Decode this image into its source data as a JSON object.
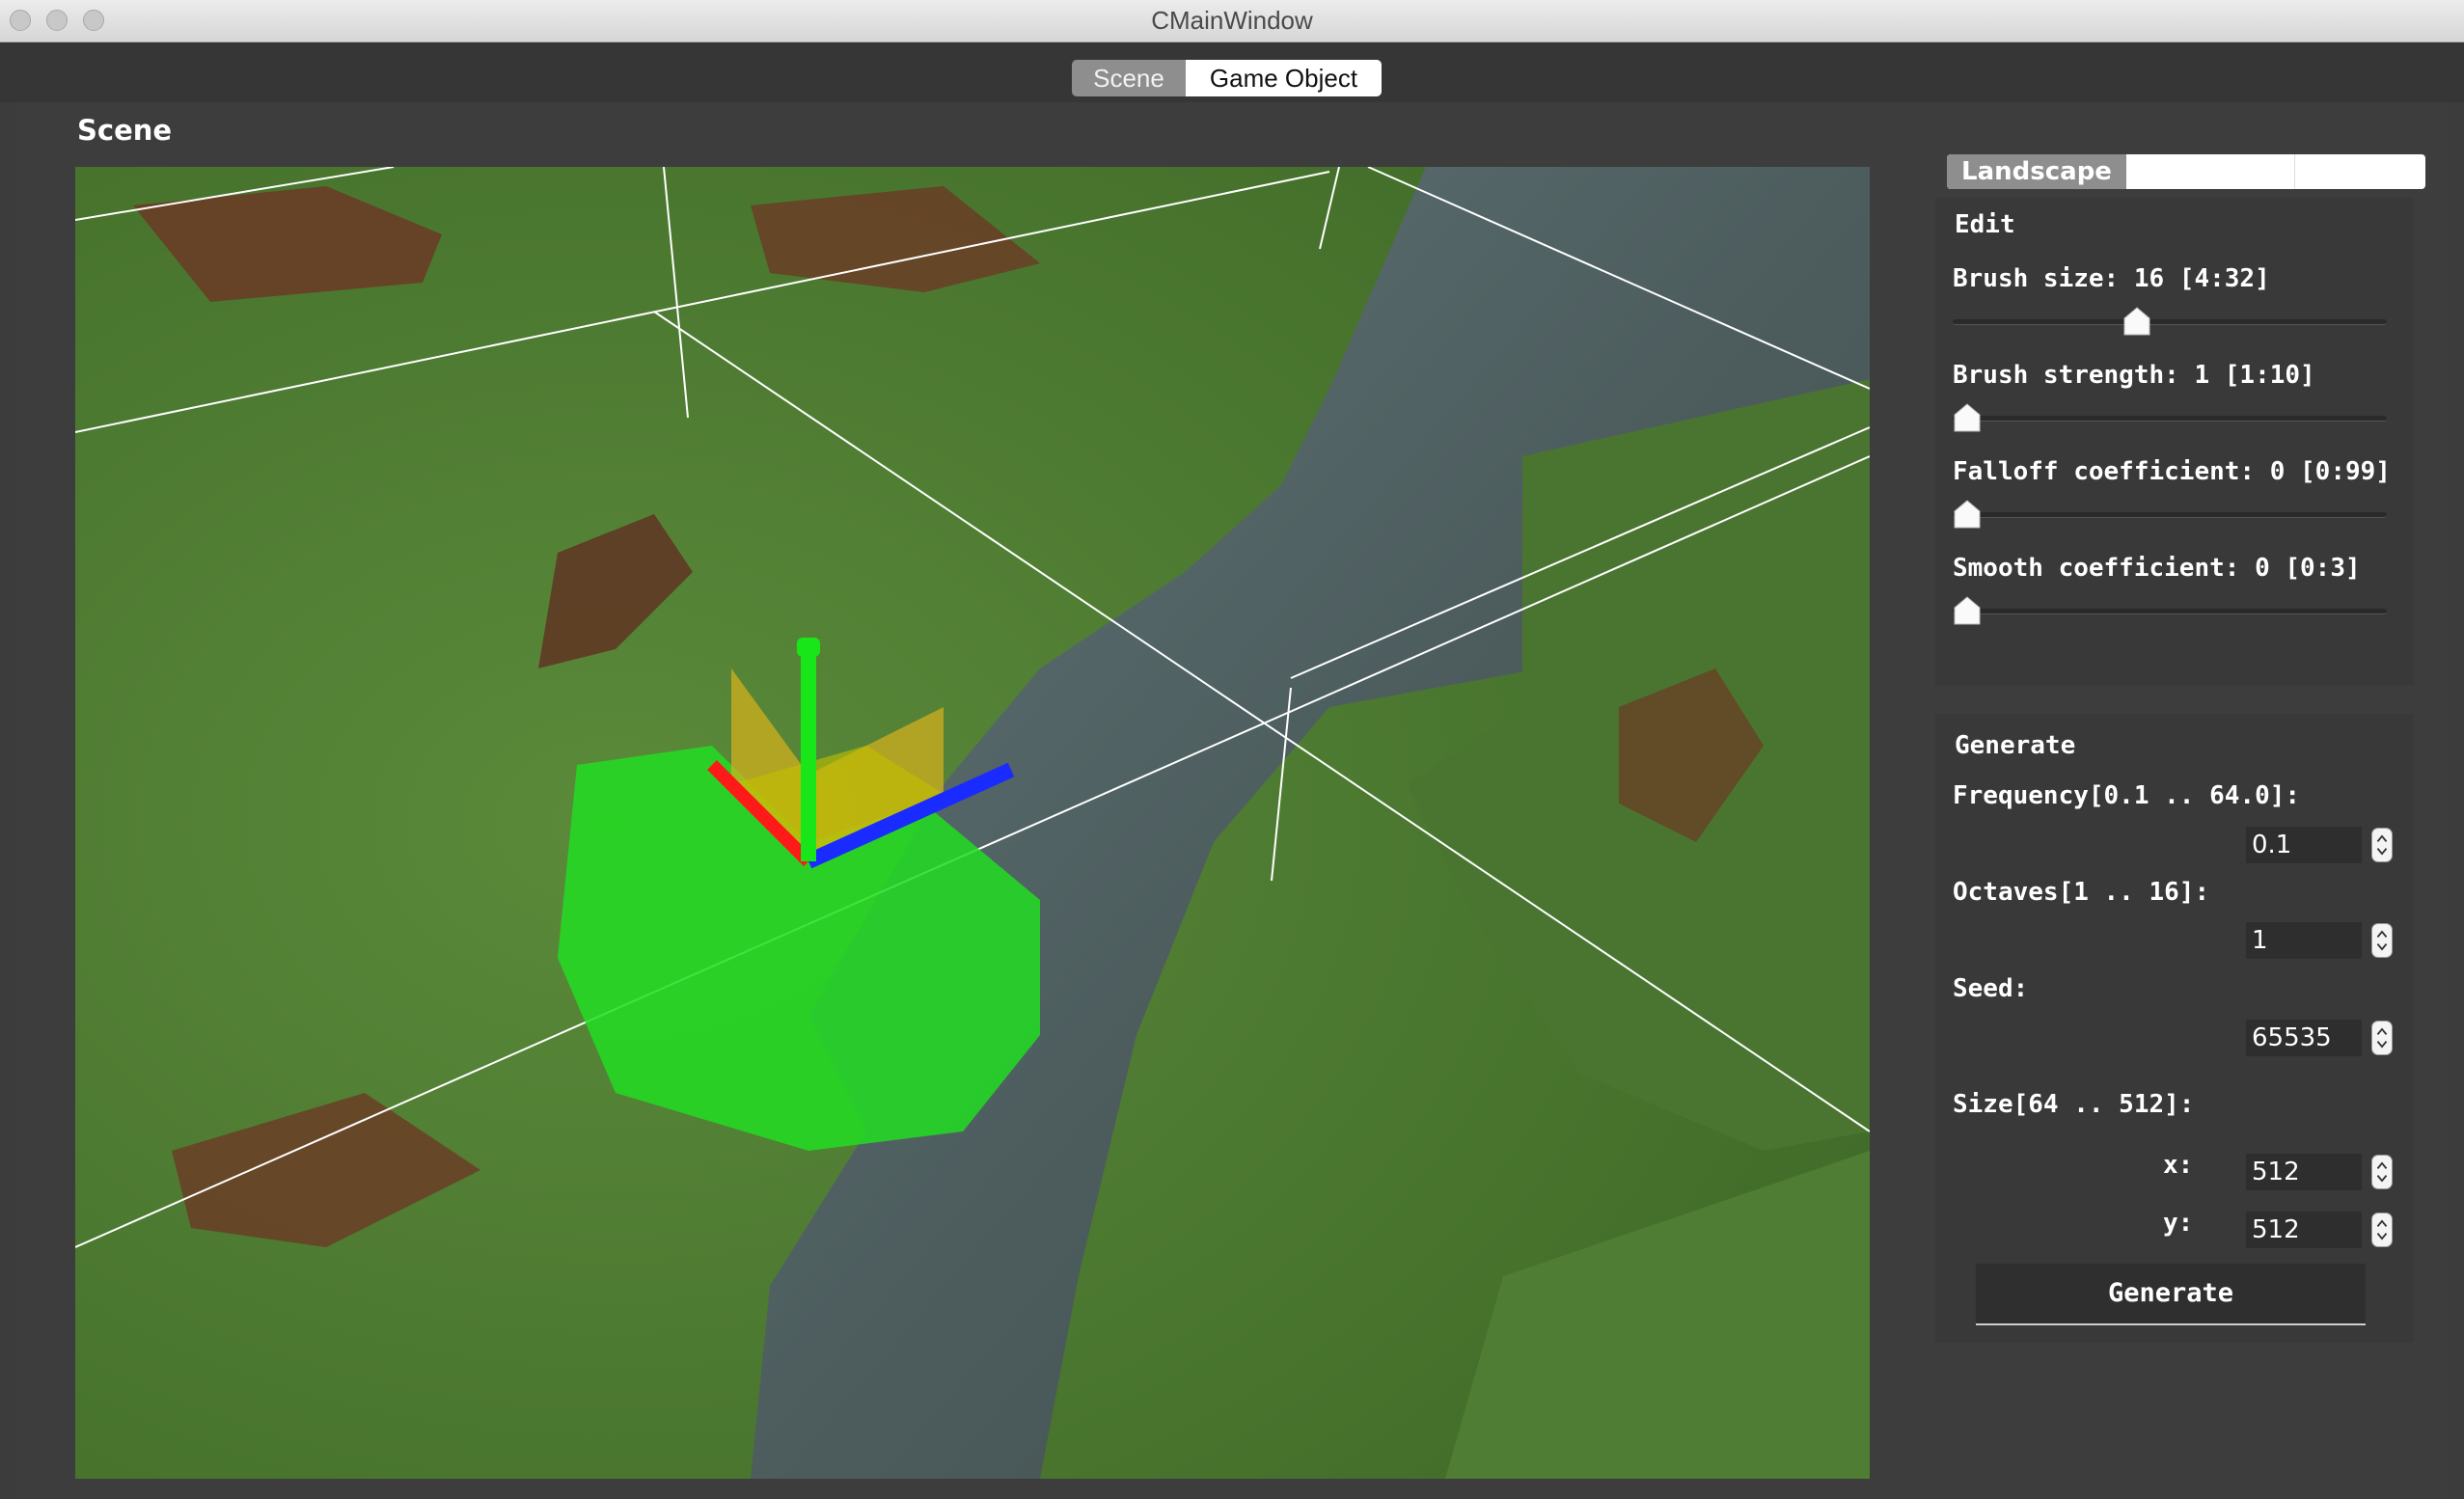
{
  "window": {
    "title": "CMainWindow"
  },
  "top_tabs": [
    {
      "label": "Scene",
      "selected": false
    },
    {
      "label": "Game Object",
      "selected": true
    }
  ],
  "scene": {
    "label": "Scene"
  },
  "panel": {
    "tabs": [
      {
        "label": "Landscape",
        "selected": true
      },
      {
        "label": ""
      },
      {
        "label": ""
      }
    ],
    "edit": {
      "title": "Edit",
      "sliders": [
        {
          "label": "Brush size: 16 [4:32]",
          "value": 16,
          "min": 4,
          "max": 32
        },
        {
          "label": "Brush strength: 1 [1:10]",
          "value": 1,
          "min": 1,
          "max": 10
        },
        {
          "label": "Falloff coefficient: 0 [0:99]",
          "value": 0,
          "min": 0,
          "max": 99
        },
        {
          "label": "Smooth coefficient: 0 [0:3]",
          "value": 0,
          "min": 0,
          "max": 3
        }
      ]
    },
    "generate": {
      "title": "Generate",
      "frequency_label": "Frequency[0.1 .. 64.0]:",
      "frequency_value": "0.1",
      "octaves_label": "Octaves[1 .. 16]:",
      "octaves_value": "1",
      "seed_label": "Seed:",
      "seed_value": "65535",
      "size_label": "Size[64 .. 512]:",
      "x_label": "x:",
      "x_value": "512",
      "y_label": "y:",
      "y_value": "512",
      "button_label": "Generate"
    }
  },
  "colors": {
    "accent_tab": "#8e8e8e",
    "gizmo_x": "#ff1a1a",
    "gizmo_y": "#19e619",
    "gizmo_z": "#1a2bff",
    "brush": "#22dd22"
  }
}
